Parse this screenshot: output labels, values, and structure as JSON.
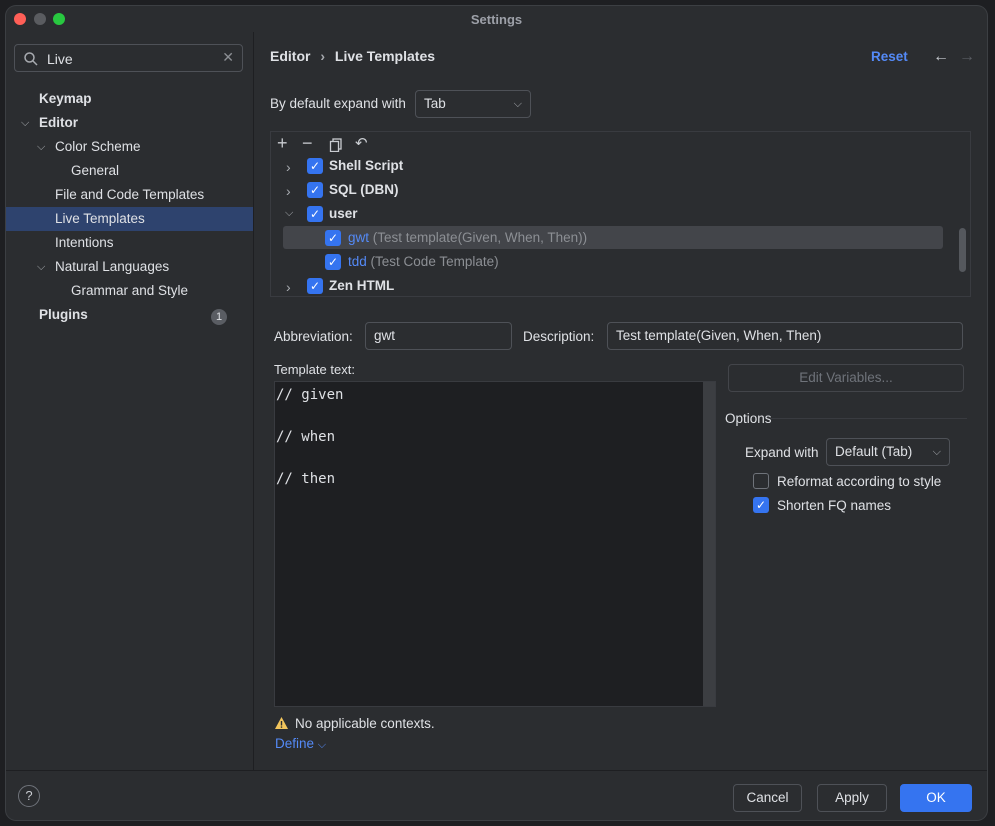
{
  "window": {
    "title": "Settings"
  },
  "sidebar": {
    "search": {
      "value": "Live"
    },
    "items": [
      {
        "label": "Keymap"
      },
      {
        "label": "Editor"
      },
      {
        "label": "Color Scheme"
      },
      {
        "label": "General"
      },
      {
        "label": "File and Code Templates"
      },
      {
        "label": "Live Templates"
      },
      {
        "label": "Intentions"
      },
      {
        "label": "Natural Languages"
      },
      {
        "label": "Grammar and Style"
      },
      {
        "label": "Plugins",
        "badge": "1"
      }
    ]
  },
  "header": {
    "breadcrumb": [
      "Editor",
      "Live Templates"
    ],
    "reset_label": "Reset"
  },
  "expand_default": {
    "label": "By default expand with",
    "value": "Tab"
  },
  "templates_tree": {
    "groups": [
      {
        "name": "Shell Script",
        "checked": true
      },
      {
        "name": "SQL (DBN)",
        "checked": true
      },
      {
        "name": "user",
        "checked": true
      },
      {
        "name": "Zen HTML",
        "checked": true
      }
    ],
    "user_items": [
      {
        "abbr": "gwt",
        "desc": "(Test template(Given, When, Then))",
        "checked": true
      },
      {
        "abbr": "tdd",
        "desc": "(Test Code Template)",
        "checked": true
      }
    ]
  },
  "details": {
    "abbreviation_label": "Abbreviation:",
    "abbreviation_value": "gwt",
    "description_label": "Description:",
    "description_value": "Test template(Given, When, Then)",
    "template_text_label": "Template text:",
    "template_lines": [
      "// given",
      "",
      "// when",
      "",
      "// then"
    ],
    "edit_variables_label": "Edit Variables...",
    "options_label": "Options",
    "expand_with_label": "Expand with",
    "expand_with_value": "Default (Tab)",
    "reformat_label": "Reformat according to style",
    "reformat_checked": false,
    "shorten_label": "Shorten FQ names",
    "shorten_checked": true,
    "warning_text": "No applicable contexts.",
    "define_label": "Define"
  },
  "footer": {
    "help_label": "?",
    "cancel_label": "Cancel",
    "apply_label": "Apply",
    "ok_label": "OK"
  },
  "colors": {
    "accent": "#3574f0",
    "selection": "#2e436e",
    "link": "#548af7"
  }
}
